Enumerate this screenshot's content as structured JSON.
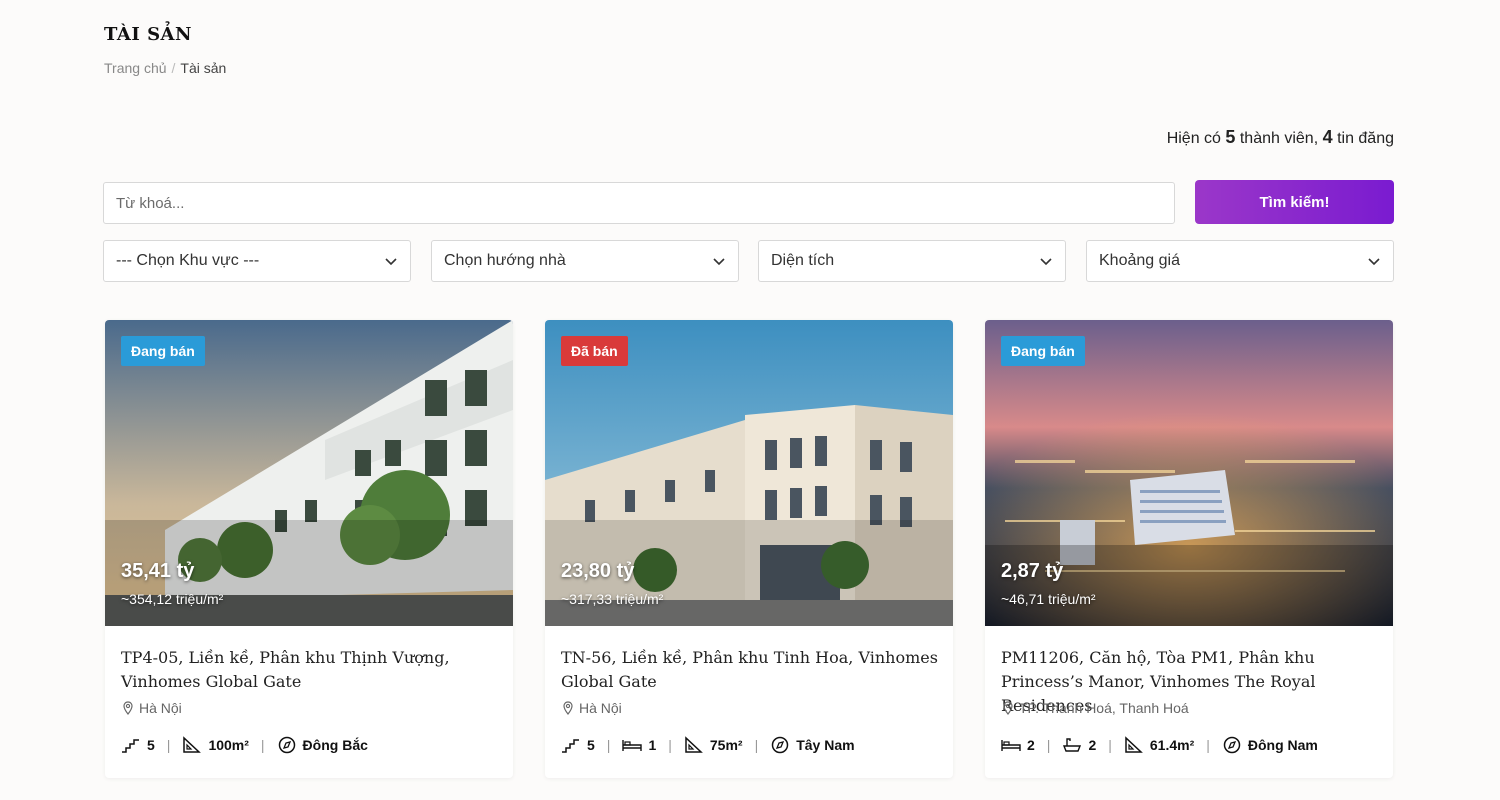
{
  "header": {
    "title": "TÀI SẢN",
    "breadcrumb": {
      "home": "Trang chủ",
      "separator": "/",
      "current": "Tài sản"
    }
  },
  "stats": {
    "prefix": "Hiện có",
    "members": "5",
    "members_label": "thành viên,",
    "listings": "4",
    "listings_label": "tin đăng"
  },
  "search": {
    "placeholder": "Từ khoá...",
    "button": "Tìm kiếm!"
  },
  "filters": {
    "region": "--- Chọn Khu vực ---",
    "direction": "Chọn hướng nhà",
    "area": "Diện tích",
    "price": "Khoảng giá"
  },
  "colors": {
    "accent": "#8a2bd0",
    "badge_selling": "#2a9bd8",
    "badge_sold": "#d93a3a"
  },
  "cards": [
    {
      "status": "Đang bán",
      "price": "35,41 tỷ",
      "price_per_sqm": "~354,12 triệu/m²",
      "title": "TP4-05, Liền kề, Phân khu Thịnh Vượng, Vinhomes Global Gate",
      "location": "Hà Nội",
      "floors": "5",
      "area": "100m²",
      "direction": "Đông Bắc"
    },
    {
      "status": "Đã bán",
      "price": "23,80 tỷ",
      "price_per_sqm": "~317,33 triệu/m²",
      "title": "TN-56, Liền kề, Phân khu Tinh Hoa, Vinhomes Global Gate",
      "location": "Hà Nội",
      "floors": "5",
      "bedrooms": "1",
      "area": "75m²",
      "direction": "Tây Nam"
    },
    {
      "status": "Đang bán",
      "price": "2,87 tỷ",
      "price_per_sqm": "~46,71 triệu/m²",
      "title": "PM11206, Căn hộ, Tòa PM1, Phân khu Princess’s Manor, Vinhomes The Royal Residences",
      "location": "TP. Thanh Hoá, Thanh Hoá",
      "bedrooms": "2",
      "bathrooms": "2",
      "area": "61.4m²",
      "direction": "Đông Nam"
    }
  ]
}
